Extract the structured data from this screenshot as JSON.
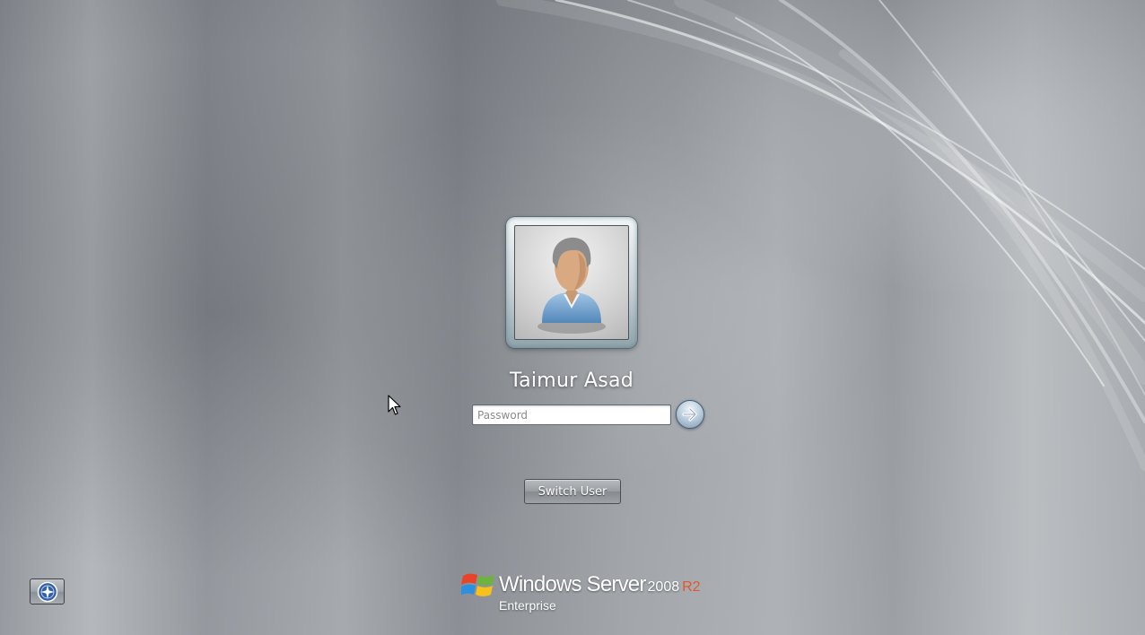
{
  "user": {
    "display_name": "Taimur Asad",
    "avatar_icon": "user-avatar-icon"
  },
  "password_field": {
    "value": "",
    "placeholder": "Password"
  },
  "submit_icon": "arrow-right-icon",
  "switch_user_label": "Switch User",
  "ease_of_access_icon": "ease-of-access-icon",
  "branding": {
    "product": "Windows Server",
    "version": "2008",
    "release": "R2",
    "edition": "Enterprise",
    "release_color": "#e2572b"
  },
  "colors": {
    "background": "#9a9ea3",
    "text": "#ffffff",
    "accent": "#7f98b0"
  }
}
